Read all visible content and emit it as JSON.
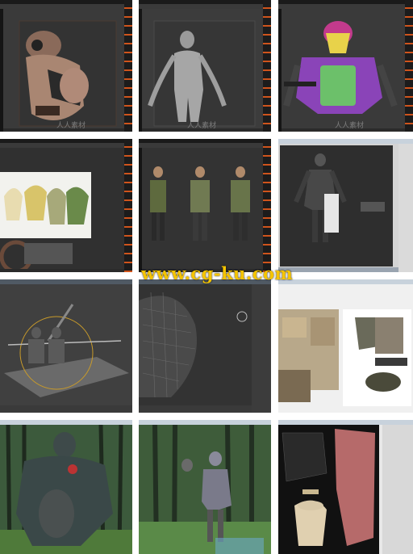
{
  "site_watermark": "www.cg-ku.com",
  "wm_text": "人人素材",
  "panels": [
    {
      "id": "p1",
      "app": "ZBrush",
      "subject": "armor-torso-sculpt"
    },
    {
      "id": "p2",
      "app": "ZBrush",
      "subject": "base-body-mesh"
    },
    {
      "id": "p3",
      "app": "ZBrush",
      "subject": "polygroups-armor"
    },
    {
      "id": "p4",
      "app": "ZBrush",
      "subject": "color-reference-popup"
    },
    {
      "id": "p5",
      "app": "ZBrush",
      "subject": "three-character-views"
    },
    {
      "id": "p6",
      "app": "3ds Max",
      "subject": "character-viewport"
    },
    {
      "id": "p7",
      "app": "3ds Max",
      "subject": "rig-transform-gizmo"
    },
    {
      "id": "p8",
      "app": "3ds Max",
      "subject": "wireframe-closeup"
    },
    {
      "id": "p9",
      "app": "Photoshop",
      "subject": "gear-reference-photos"
    },
    {
      "id": "p10",
      "app": "render",
      "subject": "forest-character-a"
    },
    {
      "id": "p11",
      "app": "render",
      "subject": "forest-character-b"
    },
    {
      "id": "p12",
      "app": "Photoshop",
      "subject": "uv-texture-map"
    }
  ],
  "colors": {
    "zbrush_accent": "#d0541c",
    "max_ui": "#c8d2dc",
    "watermark": "#f5c400"
  }
}
